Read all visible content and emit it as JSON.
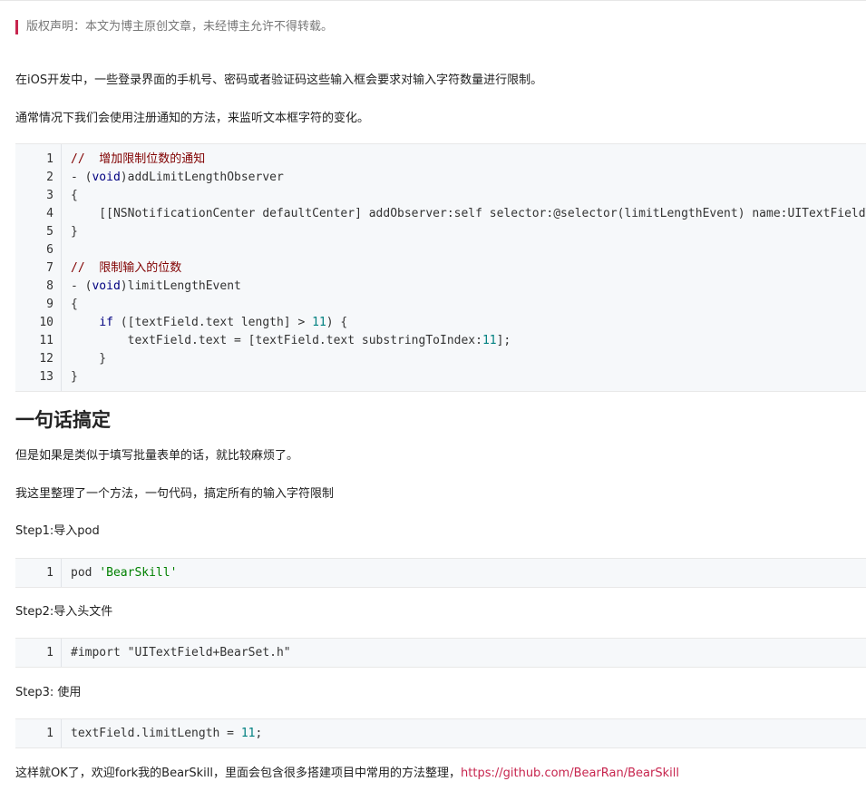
{
  "copyright": "版权声明：本文为博主原创文章，未经博主允许不得转载。",
  "paragraphs": {
    "p1": "在iOS开发中，一些登录界面的手机号、密码或者验证码这些输入框会要求对输入字符数量进行限制。",
    "p2": "通常情况下我们会使用注册通知的方法，来监听文本框字符的变化。",
    "p3": "但是如果是类似于填写批量表单的话，就比较麻烦了。",
    "p4": "我这里整理了一个方法，一句代码，搞定所有的输入字符限制",
    "step1": "Step1:导入pod",
    "step2": "Step2:导入头文件",
    "step3": "Step3: 使用",
    "final_text": "这样就OK了，欢迎fork我的BearSkill，里面会包含很多搭建项目中常用的方法整理，",
    "final_link": "https://github.com/BearRan/BearSkill"
  },
  "heading": "一句话搞定",
  "code1": {
    "line_numbers": [
      "1",
      "2",
      "3",
      "4",
      "5",
      "6",
      "7",
      "8",
      "9",
      "10",
      "11",
      "12",
      "13"
    ],
    "l1_comment": "//  增加限制位数的通知",
    "l2_a": "- (",
    "l2_kw": "void",
    "l2_b": ")addLimitLengthObserver",
    "l3": "{",
    "l4": "    [[NSNotificationCenter defaultCenter] addObserver:self selector:@selector(limitLengthEvent) name:UITextFieldTextDidChangeNotification object:nil];",
    "l5": "}",
    "l6": "",
    "l7_comment": "//  限制输入的位数",
    "l8_a": "- (",
    "l8_kw": "void",
    "l8_b": ")limitLengthEvent",
    "l9": "{",
    "l10_indent": "    ",
    "l10_kw": "if",
    "l10_a": " ([textField.text length] > ",
    "l10_num": "11",
    "l10_b": ") {",
    "l11_a": "        textField.text = [textField.text substringToIndex:",
    "l11_num": "11",
    "l11_b": "];",
    "l12": "    }",
    "l13": "}"
  },
  "code2": {
    "line_number": "1",
    "a": "pod ",
    "str": "'BearSkill'"
  },
  "code3": {
    "line_number": "1",
    "a": "#import \"UITextField+BearSet.h\""
  },
  "code4": {
    "line_number": "1",
    "a": "textField.limitLength = ",
    "num": "11",
    "b": ";"
  },
  "colors": {
    "accent": "#c7254e",
    "comment": "#800000",
    "keyword": "#000080",
    "number": "#008080",
    "string": "#008000",
    "code_bg": "#f6f8fa"
  }
}
